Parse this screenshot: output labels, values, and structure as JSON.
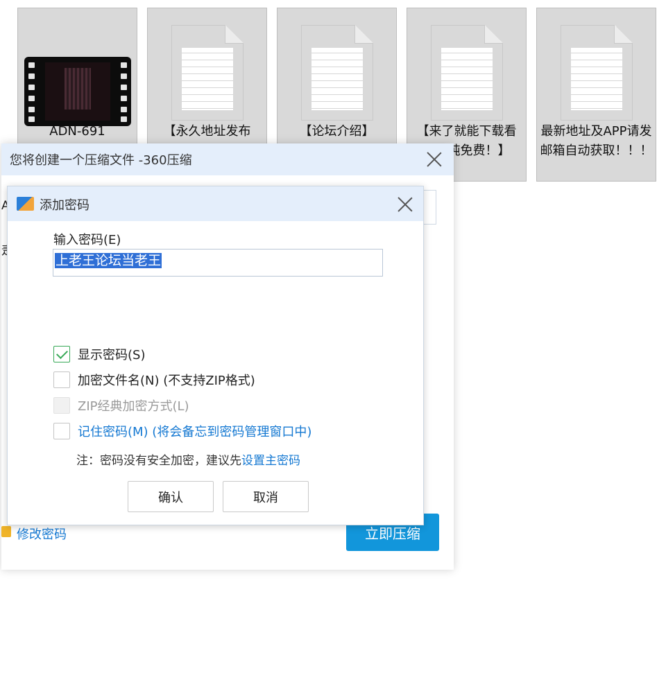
{
  "explorer": {
    "files": [
      {
        "name": "ADN-691",
        "icon": "video-file-icon"
      },
      {
        "name": "【永久地址发布",
        "icon": "text-file-icon"
      },
      {
        "name": "【论坛介绍】",
        "icon": "text-file-icon"
      },
      {
        "name": "【来了就能下载看看！纯免费！】",
        "icon": "text-file-icon"
      },
      {
        "name": "最新地址及APP请发邮箱自动获取！！！",
        "icon": "text-file-icon"
      }
    ]
  },
  "outer_window": {
    "title": "您将创建一个压缩文件 -360压缩",
    "edge_text_a": "A",
    "edge_text_b": "疌",
    "modify_password": "修改密码",
    "compress_now": "立即压缩"
  },
  "password_dialog": {
    "title": "添加密码",
    "input_label": "输入密码(E)",
    "password_value": "上老王论坛当老王",
    "options": {
      "show_password": {
        "label": "显示密码(S)",
        "checked": true
      },
      "encrypt_filenames": {
        "label": "加密文件名(N) (不支持ZIP格式)",
        "checked": false
      },
      "zip_classic": {
        "label": "ZIP经典加密方式(L)",
        "checked": false,
        "disabled": true
      },
      "remember_password": {
        "label": "记住密码(M) (将会备忘到密码管理窗口中)",
        "checked": false
      }
    },
    "note_prefix": "注：密码没有安全加密，建议先",
    "note_link": "设置主密码",
    "ok_label": "确认",
    "cancel_label": "取消"
  },
  "colors": {
    "titlebar": "#e4eefb",
    "accent_blue": "#1296db",
    "link_blue": "#1478d2",
    "check_green": "#38a957",
    "selection_blue": "#2f6fd6"
  }
}
